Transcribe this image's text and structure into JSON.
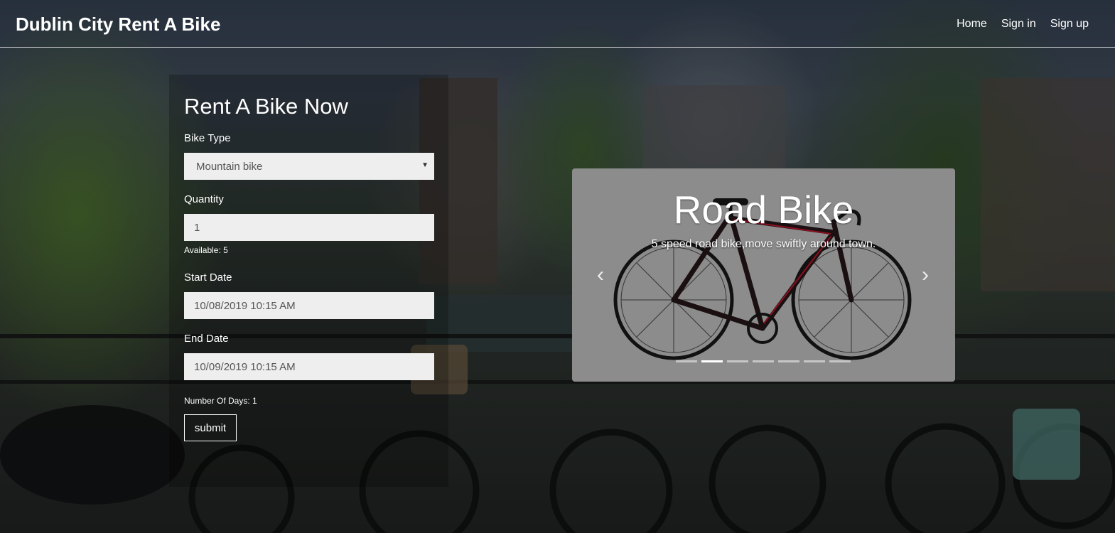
{
  "navbar": {
    "brand": "Dublin City Rent A Bike",
    "links": [
      "Home",
      "Sign in",
      "Sign up"
    ]
  },
  "form": {
    "title": "Rent A Bike Now",
    "bike_type_label": "Bike Type",
    "bike_type_value": "Mountain bike",
    "quantity_label": "Quantity",
    "quantity_value": "1",
    "available_text": "Available: 5",
    "start_date_label": "Start Date",
    "start_date_value": "10/08/2019 10:15 AM",
    "end_date_label": "End Date",
    "end_date_value": "10/09/2019 10:15 AM",
    "days_text": "Number Of Days: 1",
    "submit_label": "submit"
  },
  "carousel": {
    "title": "Road Bike",
    "caption": "5 speed road bike,move swiftly around town.",
    "slide_count": 7,
    "active_index": 1,
    "background": "#8c8c8c"
  },
  "icons": {
    "prev": "chevron-left-icon",
    "next": "chevron-right-icon",
    "select_caret": "caret-down-icon"
  }
}
